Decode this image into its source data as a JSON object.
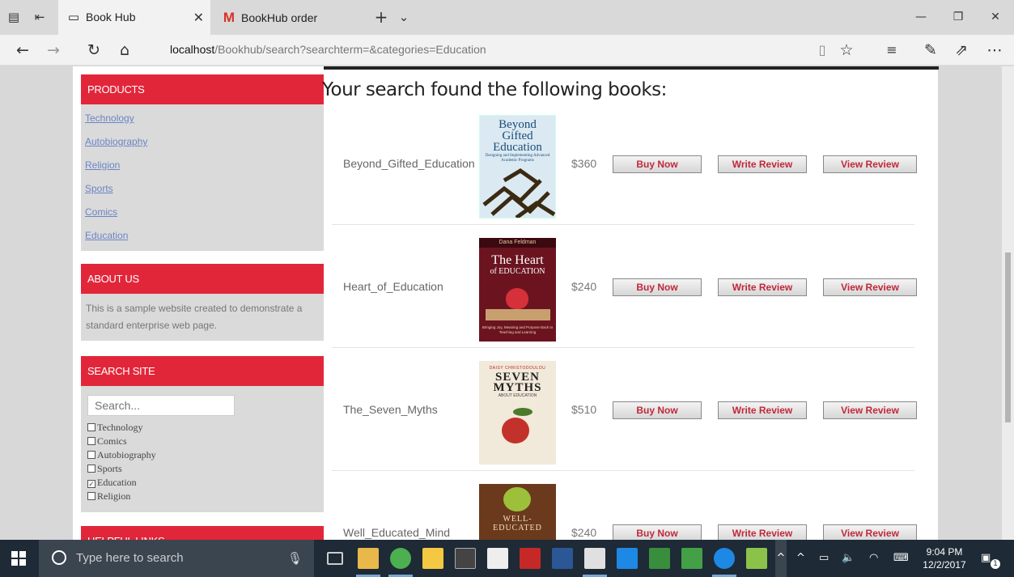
{
  "browser": {
    "tabs": [
      {
        "title": "Book Hub",
        "icon": "page-icon"
      },
      {
        "title": "BookHub order confirmatio",
        "icon": "gmail-icon"
      }
    ],
    "address_host": "localhost",
    "address_path": "/Bookhub/search?searchterm=&categories=Education"
  },
  "sidebar": {
    "products": {
      "heading": "PRODUCTS",
      "links": [
        "Technology",
        "Autobiography",
        "Religion",
        "Sports",
        "Comics",
        "Education"
      ]
    },
    "about": {
      "heading": "ABOUT US",
      "text": "This is a sample website created to demonstrate a standard enterprise web page."
    },
    "search": {
      "heading": "SEARCH SITE",
      "placeholder": "Search...",
      "categories": [
        {
          "label": "Technology",
          "checked": false
        },
        {
          "label": "Comics",
          "checked": false
        },
        {
          "label": "Autobiography",
          "checked": false
        },
        {
          "label": "Sports",
          "checked": false
        },
        {
          "label": "Education",
          "checked": true
        },
        {
          "label": "Religion",
          "checked": false
        }
      ]
    },
    "helpful": {
      "heading": "HELPFUL LINKS"
    }
  },
  "results": {
    "title": "Your search found the following books:",
    "buttons": {
      "buy": "Buy Now",
      "write": "Write Review",
      "view": "View Review"
    },
    "books": [
      {
        "name": "Beyond_Gifted_Education",
        "price": "$360",
        "cover_lines": [
          "Beyond",
          "Gifted",
          "Education"
        ],
        "cover_sub": "Designing and Implementing Advanced Academic Programs"
      },
      {
        "name": "Heart_of_Education",
        "price": "$240",
        "cover_author": "Dana Feldman",
        "cover_lines": [
          "The Heart",
          "of EDUCATION"
        ],
        "cover_sub": "Bringing Joy, Meaning and Purpose Back to Teaching and Learning"
      },
      {
        "name": "The_Seven_Myths",
        "price": "$510",
        "cover_author": "DAISY CHRISTODOULOU",
        "cover_lines": [
          "SEVEN",
          "MYTHS"
        ],
        "cover_sub": "ABOUT EDUCATION"
      },
      {
        "name": "Well_Educated_Mind",
        "price": "$240",
        "cover_lines": [
          "WELL-",
          "EDUCATED"
        ]
      }
    ]
  },
  "taskbar": {
    "search_placeholder": "Type here to search",
    "time": "9:04 PM",
    "date": "12/2/2017",
    "notifications": "1"
  },
  "colors": {
    "accent": "#e2263a",
    "sidebar_bg": "#dadada",
    "link": "#6b86c4",
    "taskbar": "#1e2a35"
  }
}
